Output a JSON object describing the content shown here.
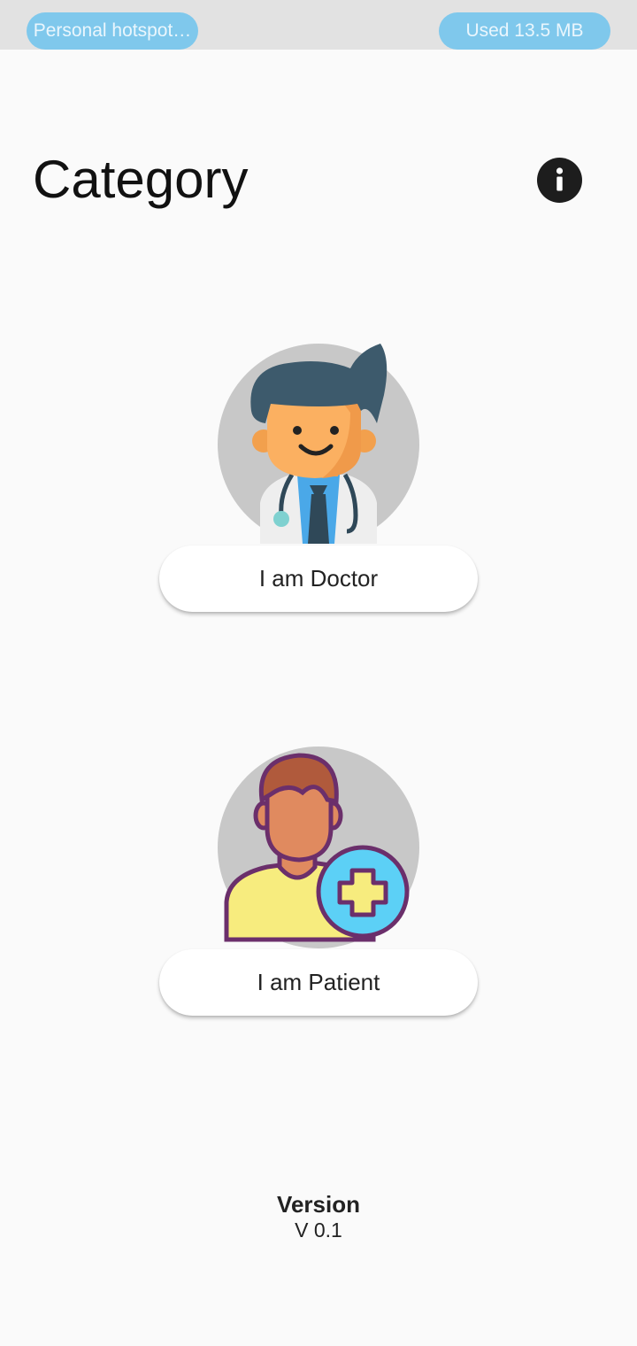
{
  "status_bar": {
    "left_pill": "Personal hotspot…",
    "right_pill": "Used  13.5 MB"
  },
  "header": {
    "title": "Category",
    "info_icon": "info-icon"
  },
  "roles": [
    {
      "label": "I am Doctor",
      "avatar": "doctor-avatar-icon"
    },
    {
      "label": "I am Patient",
      "avatar": "patient-avatar-icon"
    }
  ],
  "footer": {
    "version_title": "Version",
    "version_value": "V 0.1"
  },
  "colors": {
    "background": "#fafafa",
    "status_bar": "#e2e2e2",
    "pill": "#7fc8ec",
    "avatar_circle": "#c8c8c8",
    "info_button": "#1d1d1d"
  }
}
